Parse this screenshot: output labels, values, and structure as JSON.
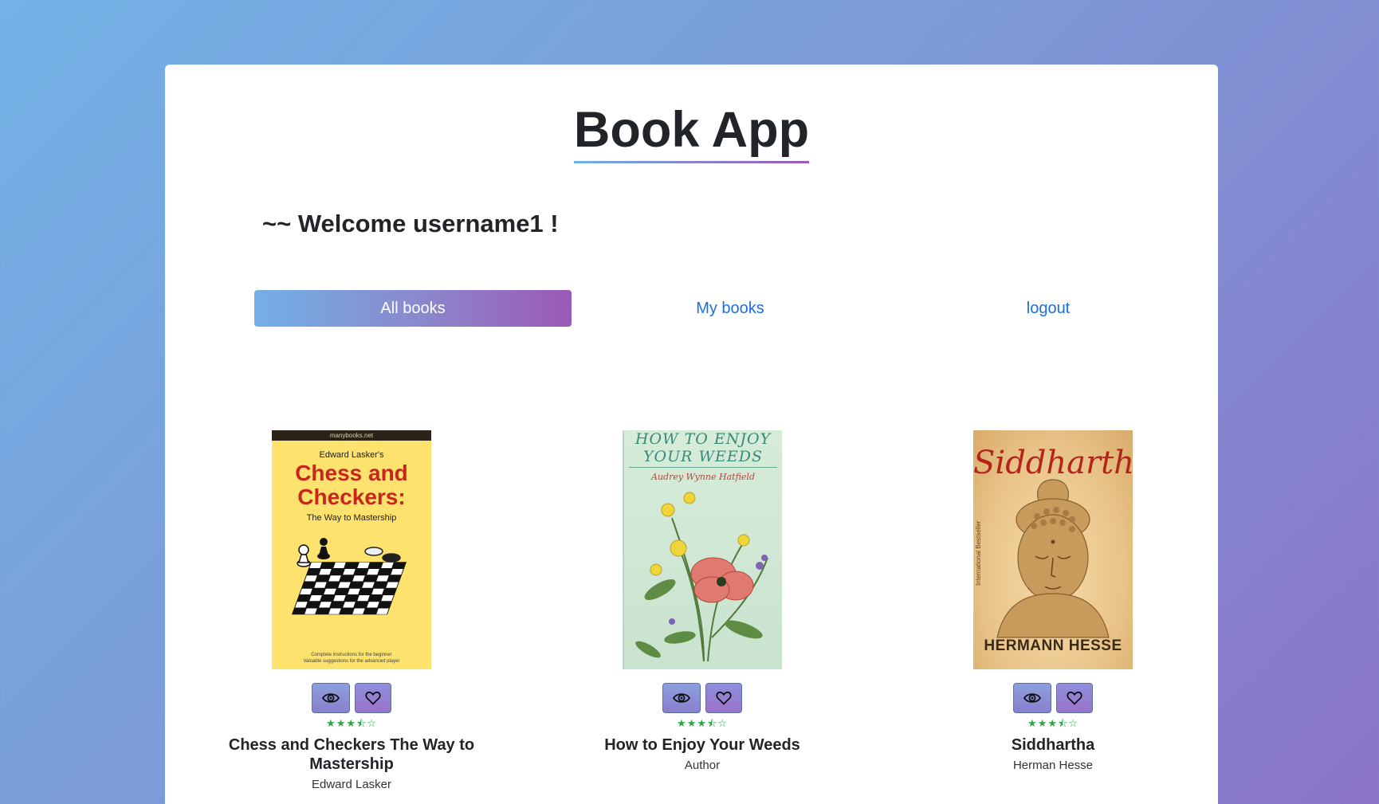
{
  "app": {
    "title": "Book App",
    "welcome": "~~ Welcome username1 !"
  },
  "nav": {
    "items": [
      {
        "label": "All books",
        "active": true
      },
      {
        "label": "My books",
        "active": false
      },
      {
        "label": "logout",
        "active": false
      }
    ]
  },
  "books": [
    {
      "title": "Chess and Checkers The Way to Mastership",
      "author": "Edward Lasker",
      "rating": 3.5,
      "cover": {
        "publisher": "manybooks.net",
        "author_line": "Edward Lasker's",
        "title": "Chess and Checkers:",
        "subtitle": "The Way to Mastership",
        "footer_1": "Complete instructions for the beginner",
        "footer_2": "Valuable suggestions for the advanced player"
      }
    },
    {
      "title": "How to Enjoy Your Weeds",
      "author": "Author",
      "rating": 3.5,
      "cover": {
        "title": "HOW TO ENJOY YOUR WEEDS",
        "author_line": "Audrey Wynne Hatfield"
      }
    },
    {
      "title": "Siddhartha",
      "author": "Herman Hesse",
      "rating": 3.5,
      "cover": {
        "title": "Siddhartha",
        "side_text": "International Bestseller",
        "author_line": "HERMANN HESSE"
      }
    }
  ],
  "icons": {
    "view": "eye-icon",
    "favorite": "heart-icon",
    "star": "star-icon"
  },
  "colors": {
    "accent_start": "#73b0e6",
    "accent_end": "#9b59b6",
    "link": "#1a6fdc",
    "star": "#28a745"
  }
}
